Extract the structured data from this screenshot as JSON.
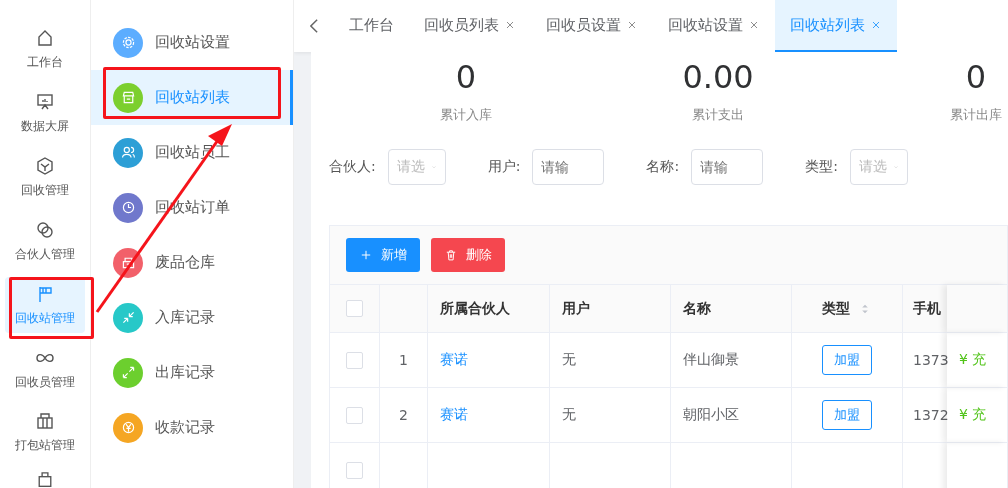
{
  "rail": {
    "items": [
      {
        "label": "工作台",
        "selected": false
      },
      {
        "label": "数据大屏",
        "selected": false
      },
      {
        "label": "回收管理",
        "selected": false
      },
      {
        "label": "合伙人管理",
        "selected": false
      },
      {
        "label": "回收站管理",
        "selected": true
      },
      {
        "label": "回收员管理",
        "selected": false
      },
      {
        "label": "打包站管理",
        "selected": false
      }
    ]
  },
  "submenu": {
    "items": [
      {
        "label": "回收站设置",
        "color": "#5cadff",
        "selected": false
      },
      {
        "label": "回收站列表",
        "color": "#7ccf2e",
        "selected": true
      },
      {
        "label": "回收站员工",
        "color": "#2d9fd6",
        "selected": false
      },
      {
        "label": "回收站订单",
        "color": "#7078cc",
        "selected": false
      },
      {
        "label": "废品仓库",
        "color": "#f2606a",
        "selected": false
      },
      {
        "label": "入库记录",
        "color": "#27c8c8",
        "selected": false
      },
      {
        "label": "出库记录",
        "color": "#6ccf2e",
        "selected": false
      },
      {
        "label": "收款记录",
        "color": "#f5a623",
        "selected": false
      }
    ]
  },
  "tabs": [
    {
      "label": "工作台",
      "closable": false,
      "selected": false
    },
    {
      "label": "回收员列表",
      "closable": true,
      "selected": false
    },
    {
      "label": "回收员设置",
      "closable": true,
      "selected": false
    },
    {
      "label": "回收站设置",
      "closable": true,
      "selected": false
    },
    {
      "label": "回收站列表",
      "closable": true,
      "selected": true
    }
  ],
  "stats": [
    {
      "value": "0",
      "label": "累计入库"
    },
    {
      "value": "0.00",
      "label": "累计支出"
    },
    {
      "value": "0",
      "label": "累计出库"
    }
  ],
  "filters": [
    {
      "label": "合伙人:",
      "placeholder": "请选",
      "kind": "select"
    },
    {
      "label": "用户:",
      "placeholder": "请输",
      "kind": "input"
    },
    {
      "label": "名称:",
      "placeholder": "请输",
      "kind": "input"
    },
    {
      "label": "类型:",
      "placeholder": "请选",
      "kind": "select"
    }
  ],
  "toolbar": {
    "add": "新增",
    "delete": "删除"
  },
  "table": {
    "columns": [
      "所属合伙人",
      "用户",
      "名称",
      "类型",
      "手机"
    ],
    "rows": [
      {
        "checked": false,
        "index": "1",
        "partner": "赛诺",
        "user": "无",
        "name": "伴山御景",
        "type": "加盟",
        "phone": "1373",
        "action": "充"
      },
      {
        "checked": false,
        "index": "2",
        "partner": "赛诺",
        "user": "无",
        "name": "朝阳小区",
        "type": "加盟",
        "phone": "1372",
        "action": "充"
      }
    ],
    "action_icon": "¥",
    "select_all": {
      "checked": false
    },
    "partial_row": {
      "checked": false
    }
  }
}
